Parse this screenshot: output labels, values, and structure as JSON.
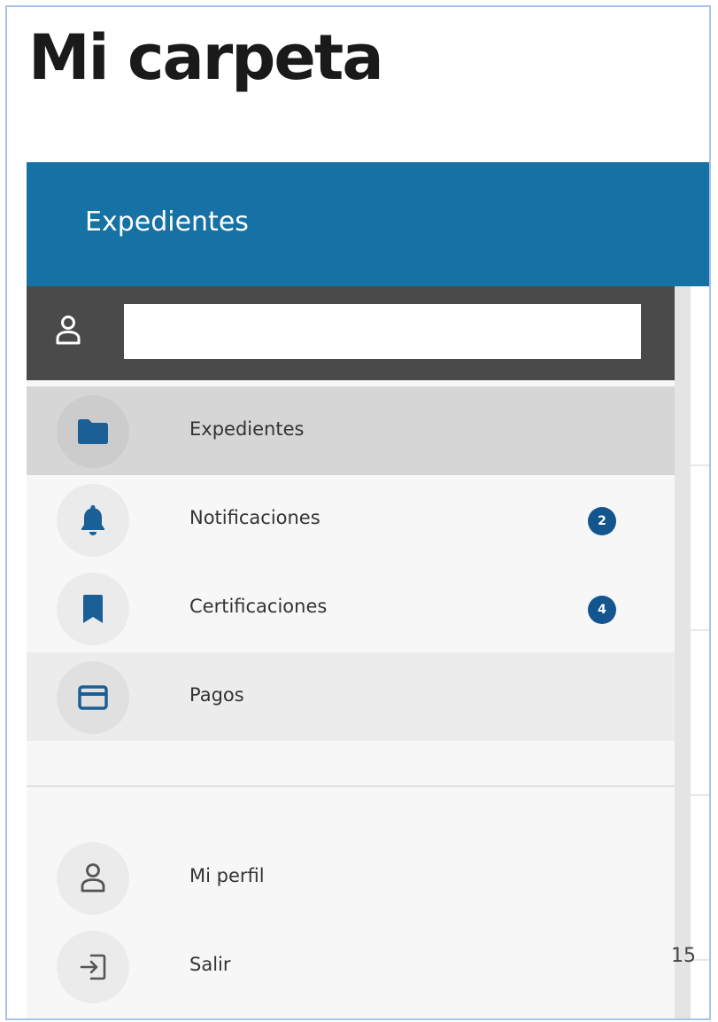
{
  "page": {
    "title": "Mi carpeta",
    "page_number": "15"
  },
  "header": {
    "title": "Expedientes",
    "background": "#1671a5"
  },
  "user_bar": {
    "icon": "user-icon",
    "search_value": ""
  },
  "nav": {
    "items": [
      {
        "label": "Expedientes",
        "icon": "folder-icon",
        "badge": "",
        "state": "active"
      },
      {
        "label": "Notificaciones",
        "icon": "bell-icon",
        "badge": "2",
        "state": ""
      },
      {
        "label": "Certificaciones",
        "icon": "bookmark-icon",
        "badge": "4",
        "state": ""
      },
      {
        "label": "Pagos",
        "icon": "credit-card-icon",
        "badge": "",
        "state": "hover"
      }
    ],
    "footer": [
      {
        "label": "Mi perfil",
        "icon": "user-icon"
      },
      {
        "label": "Salir",
        "icon": "logout-icon"
      }
    ]
  },
  "colors": {
    "accent": "#1671a5",
    "badge": "#13558c",
    "icon": "#1a5f95",
    "sidebar_dark": "#4a4a4a"
  }
}
